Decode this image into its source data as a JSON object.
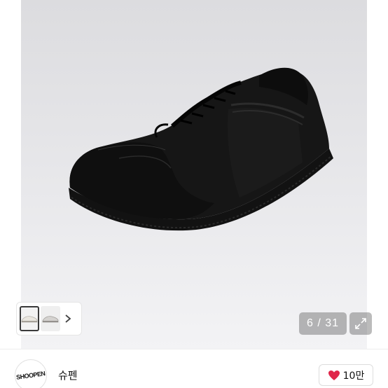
{
  "gallery": {
    "current_page": "6",
    "total_pages": "31",
    "counter_text": "6 / 31",
    "thumbnails": [
      "shoe-thumbnail-white",
      "shoe-thumbnail-grey"
    ],
    "next_icon": "chevron-right-icon",
    "expand_icon": "expand-arrows-icon"
  },
  "seller": {
    "avatar_text": "SHOOPEN",
    "name": "슈펜"
  },
  "like": {
    "icon": "heart-icon",
    "icon_color": "#e0264a",
    "count": "10만"
  }
}
